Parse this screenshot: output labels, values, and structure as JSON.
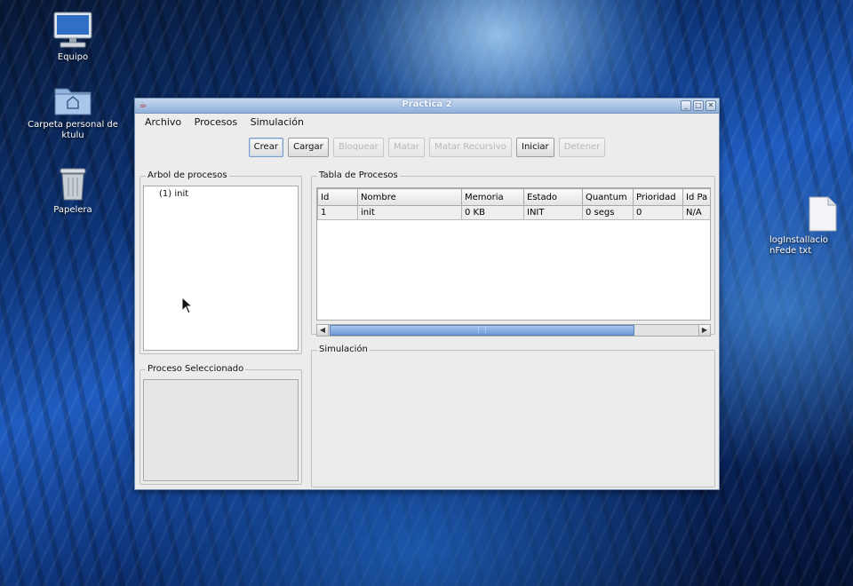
{
  "desktop": {
    "icons": [
      {
        "label": "Equipo",
        "icon": "computer-icon"
      },
      {
        "label": "Carpeta personal de ktulu",
        "icon": "home-folder-icon"
      },
      {
        "label": "Papelera",
        "icon": "trash-icon"
      },
      {
        "label": "logInstallacionFede txt",
        "icon": "text-file-icon"
      }
    ]
  },
  "window": {
    "title": "Practica 2",
    "menu": [
      "Archivo",
      "Procesos",
      "Simulación"
    ],
    "toolbar": {
      "crear": "Crear",
      "cargar": "Cargar",
      "bloquear": "Bloquear",
      "matar": "Matar",
      "matar_recursivo": "Matar Recursivo",
      "iniciar": "Iniciar",
      "detener": "Detener"
    },
    "tree": {
      "title": "Arbol de procesos",
      "root": "(1) init"
    },
    "selected": {
      "title": "Proceso Seleccionado"
    },
    "table": {
      "title": "Tabla de Procesos",
      "columns": [
        "Id",
        "Nombre",
        "Memoria",
        "Estado",
        "Quantum",
        "Prioridad",
        "Id Pa"
      ],
      "rows": [
        [
          "1",
          "init",
          "0 KB",
          "INIT",
          "0 segs",
          "0",
          "N/A"
        ]
      ]
    },
    "simulation": {
      "title": "Simulación"
    }
  },
  "colors": {
    "titlebar": "#8eb0da",
    "window_bg": "#ececec",
    "scroll_thumb": "#6e9ad6"
  }
}
